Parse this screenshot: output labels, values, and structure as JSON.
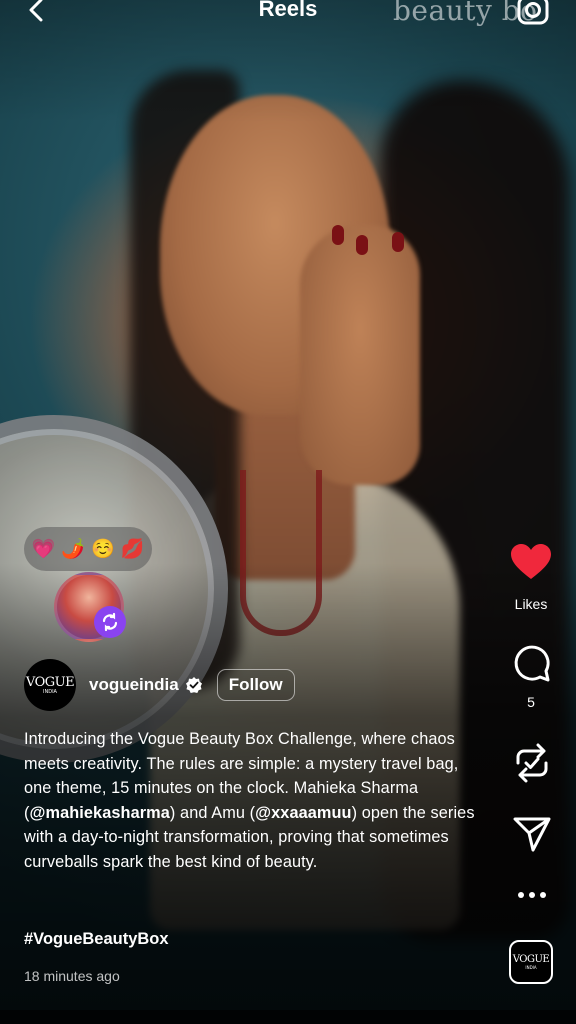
{
  "header": {
    "title": "Reels",
    "watermark": "beauty bo"
  },
  "reactions": {
    "emojis": [
      "💗",
      "🌶️",
      "☺️",
      "💋"
    ]
  },
  "account": {
    "avatar_text": "VOGUE",
    "avatar_subtext": "INDIA",
    "username": "vogueindia",
    "follow_label": "Follow"
  },
  "caption": {
    "text_1": "Introducing the Vogue Beauty Box Challenge, where chaos meets creativity. The rules are simple: a mystery travel bag, one theme, 15 minutes on the clock. Mahieka Sharma (",
    "mention_1": "@mahiekasharma",
    "text_2": ") and Amu (",
    "mention_2": "@xxaaamuu",
    "text_3": ") open the series with a day-to-night transformation, proving that sometimes curveballs spark the best kind of beauty.",
    "hashtag": "#VogueBeautyBox",
    "timestamp": "18 minutes ago"
  },
  "actions": {
    "like_label": "Likes",
    "comment_count": "5",
    "audio_text": "VOGUE",
    "audio_subtext": "INDIA"
  },
  "colors": {
    "like_heart": "#f0283c",
    "remix_badge": "#8a43f0"
  },
  "icons": [
    "back-arrow-icon",
    "camera-icon",
    "verified-icon",
    "heart-icon",
    "comment-icon",
    "repost-icon",
    "share-icon",
    "more-icon",
    "remix-icon"
  ]
}
